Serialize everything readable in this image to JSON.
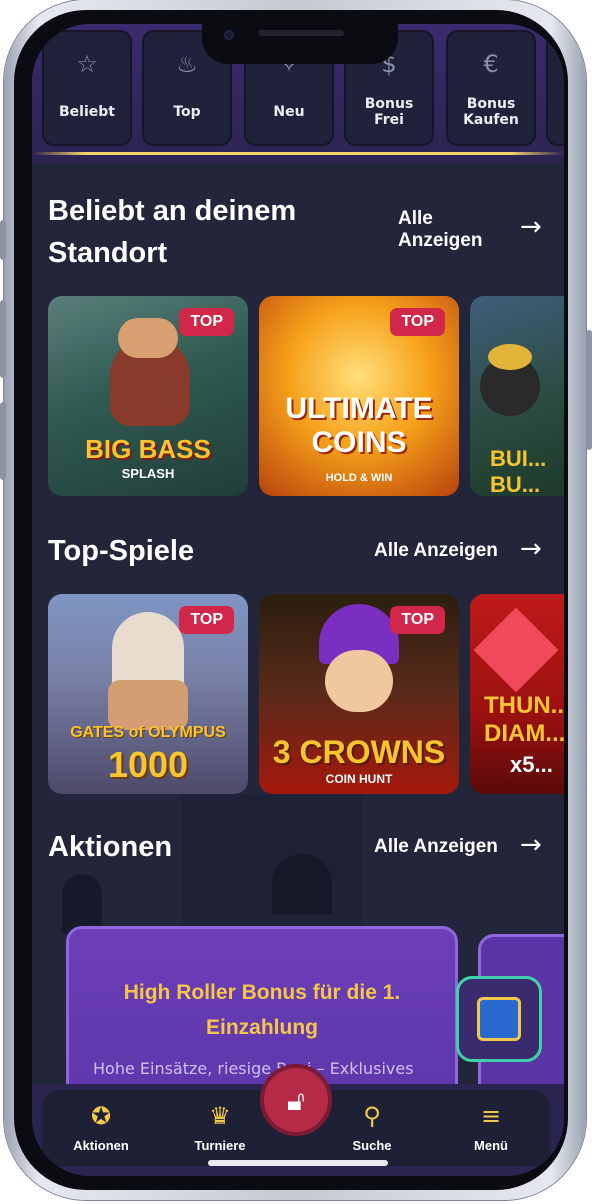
{
  "categories": [
    {
      "label": "Beliebt",
      "icon": "star-icon"
    },
    {
      "label": "Top",
      "icon": "flame-icon"
    },
    {
      "label": "Neu",
      "icon": "sparkle-icon"
    },
    {
      "label": "Bonus Frei",
      "icon": "coin-bag-icon"
    },
    {
      "label": "Bonus Kaufen",
      "icon": "money-bag-icon"
    }
  ],
  "section1": {
    "title": "Beliebt an deinem Standort",
    "see_all": "Alle Anzeigen"
  },
  "section1_games": [
    {
      "name": "BIG BASS",
      "sub": "SPLASH",
      "badge": "TOP"
    },
    {
      "name": "ULTIMATE COINS",
      "sub": "HOLD & WIN",
      "badge": "TOP"
    },
    {
      "name": "BUI... BU...",
      "badge": ""
    }
  ],
  "section2": {
    "title": "Top-Spiele",
    "see_all": "Alle Anzeigen"
  },
  "section2_games": [
    {
      "name": "GATES of OLYMPUS",
      "sub": "1000",
      "badge": "TOP"
    },
    {
      "name": "3 CROWNS",
      "sub": "COIN HUNT",
      "badge": "TOP"
    },
    {
      "name": "THUN... DIAM...",
      "sub": "x5...",
      "badge": ""
    }
  ],
  "section3": {
    "title": "Aktionen",
    "see_all": "Alle Anzeigen"
  },
  "promo": {
    "title": "High Roller Bonus für die 1. Einzahlung",
    "subtitle": "Hohe Einsätze, riesige Boni – Exklusives"
  },
  "nav": [
    {
      "label": "Aktionen",
      "icon": "shield-star-icon"
    },
    {
      "label": "Turniere",
      "icon": "trophy-icon"
    },
    {
      "label": "Suche",
      "icon": "search-icon"
    },
    {
      "label": "Menü",
      "icon": "menu-icon"
    }
  ],
  "colors": {
    "accent": "#f2c94c",
    "badge": "#d1274b",
    "background": "#23263a",
    "promo": "#5a33a6"
  }
}
